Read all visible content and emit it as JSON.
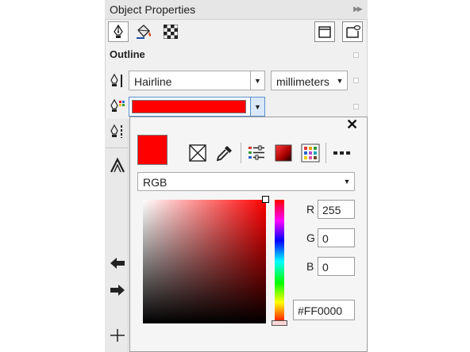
{
  "window": {
    "title": "Object Properties"
  },
  "outline": {
    "section_title": "Outline",
    "width_value": "Hairline",
    "units_value": "millimeters",
    "color_hex": "#FF0000"
  },
  "picker": {
    "model_value": "RGB",
    "r_label": "R",
    "g_label": "G",
    "b_label": "B",
    "r": "255",
    "g": "0",
    "b": "0",
    "hex": "#FF0000",
    "current_color": "#FF0000"
  }
}
